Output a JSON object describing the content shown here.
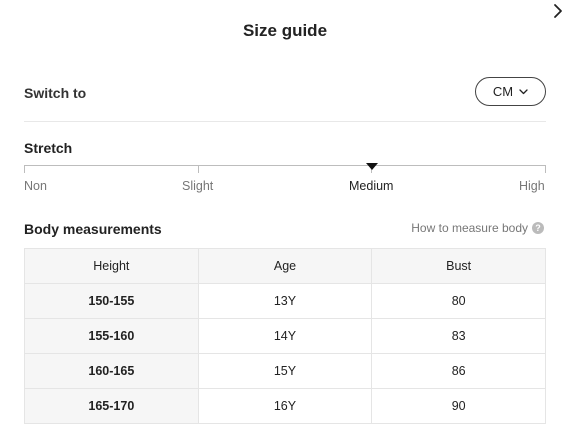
{
  "header": {
    "title": "Size guide",
    "close_icon": "chevron-right-icon"
  },
  "unit_switch": {
    "label": "Switch to",
    "selected": "CM",
    "dropdown_icon": "chevron-down-icon"
  },
  "stretch": {
    "label": "Stretch",
    "levels": [
      "Non",
      "Slight",
      "Medium",
      "High"
    ],
    "selected": "Medium"
  },
  "body_measurements": {
    "label": "Body measurements",
    "help_link": "How to measure body",
    "help_icon": "question-mark-icon",
    "columns": [
      "Height",
      "Age",
      "Bust"
    ],
    "rows": [
      [
        "150-155",
        "13Y",
        "80"
      ],
      [
        "155-160",
        "14Y",
        "83"
      ],
      [
        "160-165",
        "15Y",
        "86"
      ],
      [
        "165-170",
        "16Y",
        "90"
      ]
    ]
  }
}
